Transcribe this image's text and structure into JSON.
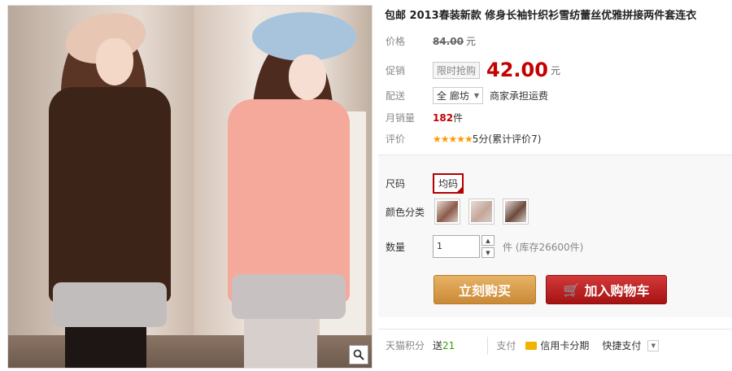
{
  "product": {
    "title": "包邮 2013春装新款 修身长袖针织衫雪纺蕾丝优雅拼接两件套连衣",
    "price_label": "价格",
    "old_price": "84.00",
    "yuan": "元",
    "promo_label": "促销",
    "promo_tag": "限时抢购",
    "promo_price": "42.00",
    "shipping_label": "配送",
    "shipping_from": "全 廊坊",
    "shipping_note": "商家承担运费",
    "monthly_sales_label": "月销量",
    "monthly_sales_value": "182",
    "monthly_sales_unit": "件",
    "rating_label": "评价",
    "rating_stars": "★★★★★",
    "rating_text": "5分(累计评价7)"
  },
  "spec": {
    "size_label": "尺码",
    "size_option": "均码",
    "color_label": "颜色分类",
    "color_options": [
      "#8b5a4a",
      "#c4a79a",
      "#6b4a3e"
    ],
    "qty_label": "数量",
    "qty_value": "1",
    "stock_text": "件 (库存26600件)",
    "stepper_up": "▲",
    "stepper_down": "▼"
  },
  "buttons": {
    "buy_now": "立刻购买",
    "add_to_cart": "加入购物车",
    "cart_icon": "🛒"
  },
  "bottom": {
    "points_label": "天猫积分",
    "points_prefix": "送",
    "points_value": "21",
    "pay_label": "支付",
    "credit_card": "信用卡分期",
    "quick_pay": "快捷支付",
    "dropdown_icon": "▼"
  },
  "icons": {
    "zoom": "magnifier-icon"
  }
}
